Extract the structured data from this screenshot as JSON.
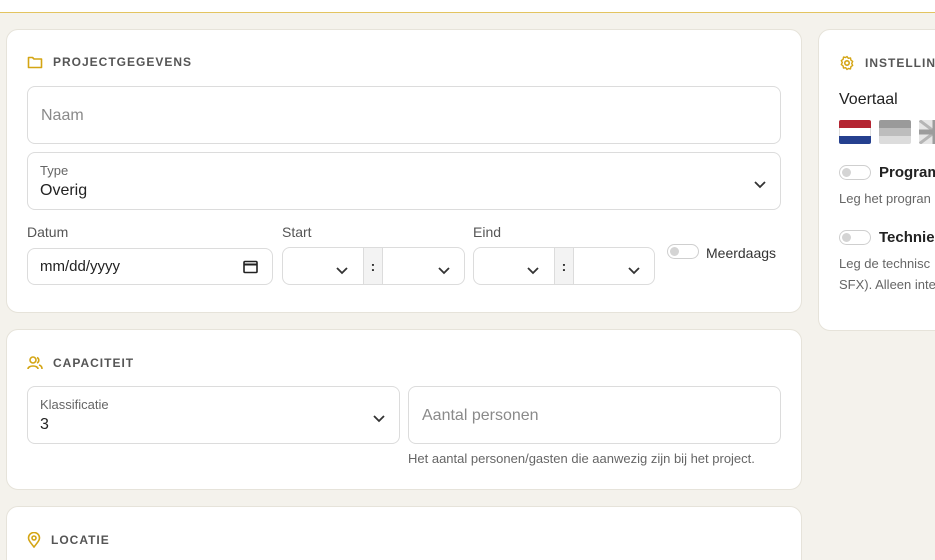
{
  "project_card": {
    "title": "PROJECTGEGEVENS",
    "naam_placeholder": "Naam",
    "type_label": "Type",
    "type_value": "Overig",
    "datum_label": "Datum",
    "datum_placeholder": "mm/dd/yyyy",
    "start_label": "Start",
    "eind_label": "Eind",
    "time_separator": ":",
    "meerdaags_label": "Meerdaags"
  },
  "capacity_card": {
    "title": "CAPACITEIT",
    "klassificatie_label": "Klassificatie",
    "klassificatie_value": "3",
    "personen_placeholder": "Aantal personen",
    "personen_hint": "Het aantal personen/gasten die aanwezig zijn bij het project."
  },
  "location_card": {
    "title": "LOCATIE"
  },
  "settings_card": {
    "title": "INSTELLING",
    "voertaal_label": "Voertaal",
    "programma_label": "Program",
    "programma_desc": "Leg het progran",
    "techniek_label": "Technie",
    "techniek_desc_line1": "Leg de technisc",
    "techniek_desc_line2": "SFX). Alleen inte"
  },
  "colors": {
    "accent": "#d4a514",
    "background": "#f4f2ec",
    "card": "#ffffff"
  }
}
